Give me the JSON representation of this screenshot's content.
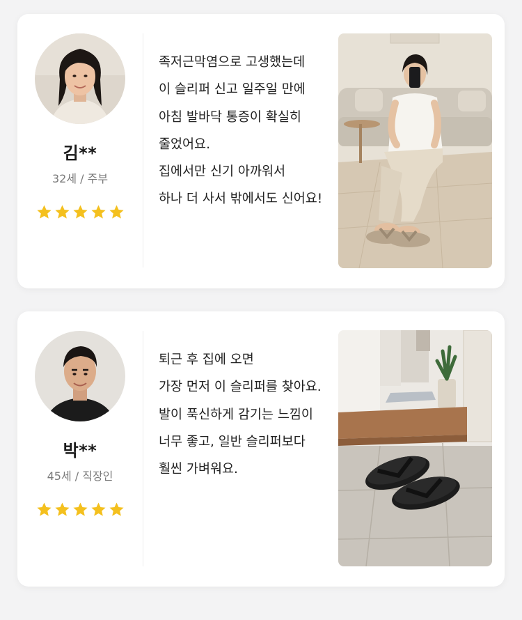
{
  "reviews": [
    {
      "name": "김**",
      "meta": "32세 / 주부",
      "rating": 5,
      "text_lines": [
        "족저근막염으로 고생했는데",
        "이 슬리퍼 신고 일주일 만에",
        "아침 발바닥 통증이 확실히",
        "줄었어요.",
        "집에서만 신기 아까워서",
        "하나 더 사서 밖에서도 신어요!"
      ],
      "photo_icon": "woman-sitting-wearing-slippers-photo"
    },
    {
      "name": "박**",
      "meta": "45세 / 직장인",
      "rating": 5,
      "text_lines": [
        "퇴근 후 집에 오면",
        "가장 먼저 이 슬리퍼를 찾아요.",
        "발이 푹신하게 감기는 느낌이",
        "너무 좋고, 일반 슬리퍼보다",
        "훨씬 가벼워요."
      ],
      "photo_icon": "black-slippers-entryway-photo"
    }
  ],
  "colors": {
    "star": "#f4c01e",
    "card": "#ffffff",
    "background": "#f3f3f4"
  }
}
